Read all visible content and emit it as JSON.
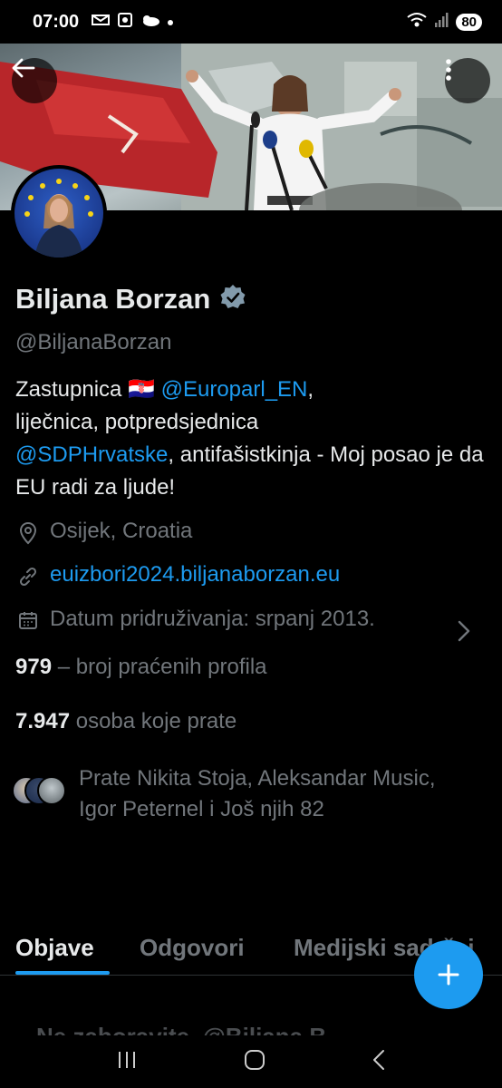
{
  "status_bar": {
    "time": "07:00",
    "battery": "80",
    "icons_left": [
      "mail-icon",
      "screenshot-icon",
      "weather-icon",
      "dot-icon"
    ],
    "icons_right": [
      "wifi-icon",
      "signal-icon",
      "battery-icon"
    ]
  },
  "profile": {
    "name": "Biljana Borzan",
    "handle": "@BiljanaBorzan",
    "verified": true,
    "bio": {
      "part1": "Zastupnica 🇭🇷 ",
      "mention1": "@Europarl_EN",
      "part2": ",\nliječnica, potpredsjednica\n",
      "mention2": "@SDPHrvatske",
      "part3": ", antifašistkinja - Moj posao je da EU radi za ljude!"
    },
    "location": "Osijek, Croatia",
    "website": "euizbori2024.biljanaborzan.eu",
    "joined": "Datum pridruživanja: srpanj 2013.",
    "following_count": "979",
    "following_label": " – broj praćenih profila",
    "followers_count": "7.947",
    "followers_label": " osoba koje prate",
    "followed_by": "Prate Nikita Stoja, Aleksandar Music, Igor Peternel i Još njih 82"
  },
  "tabs": [
    {
      "label": "Objave",
      "active": true
    },
    {
      "label": "Odgovori",
      "active": false
    },
    {
      "label": "Medijski sadržaj",
      "active": false
    }
  ],
  "colors": {
    "accent": "#1d9bf0",
    "text_primary": "#e7e9ea",
    "text_secondary": "#71767b",
    "background": "#000000"
  }
}
